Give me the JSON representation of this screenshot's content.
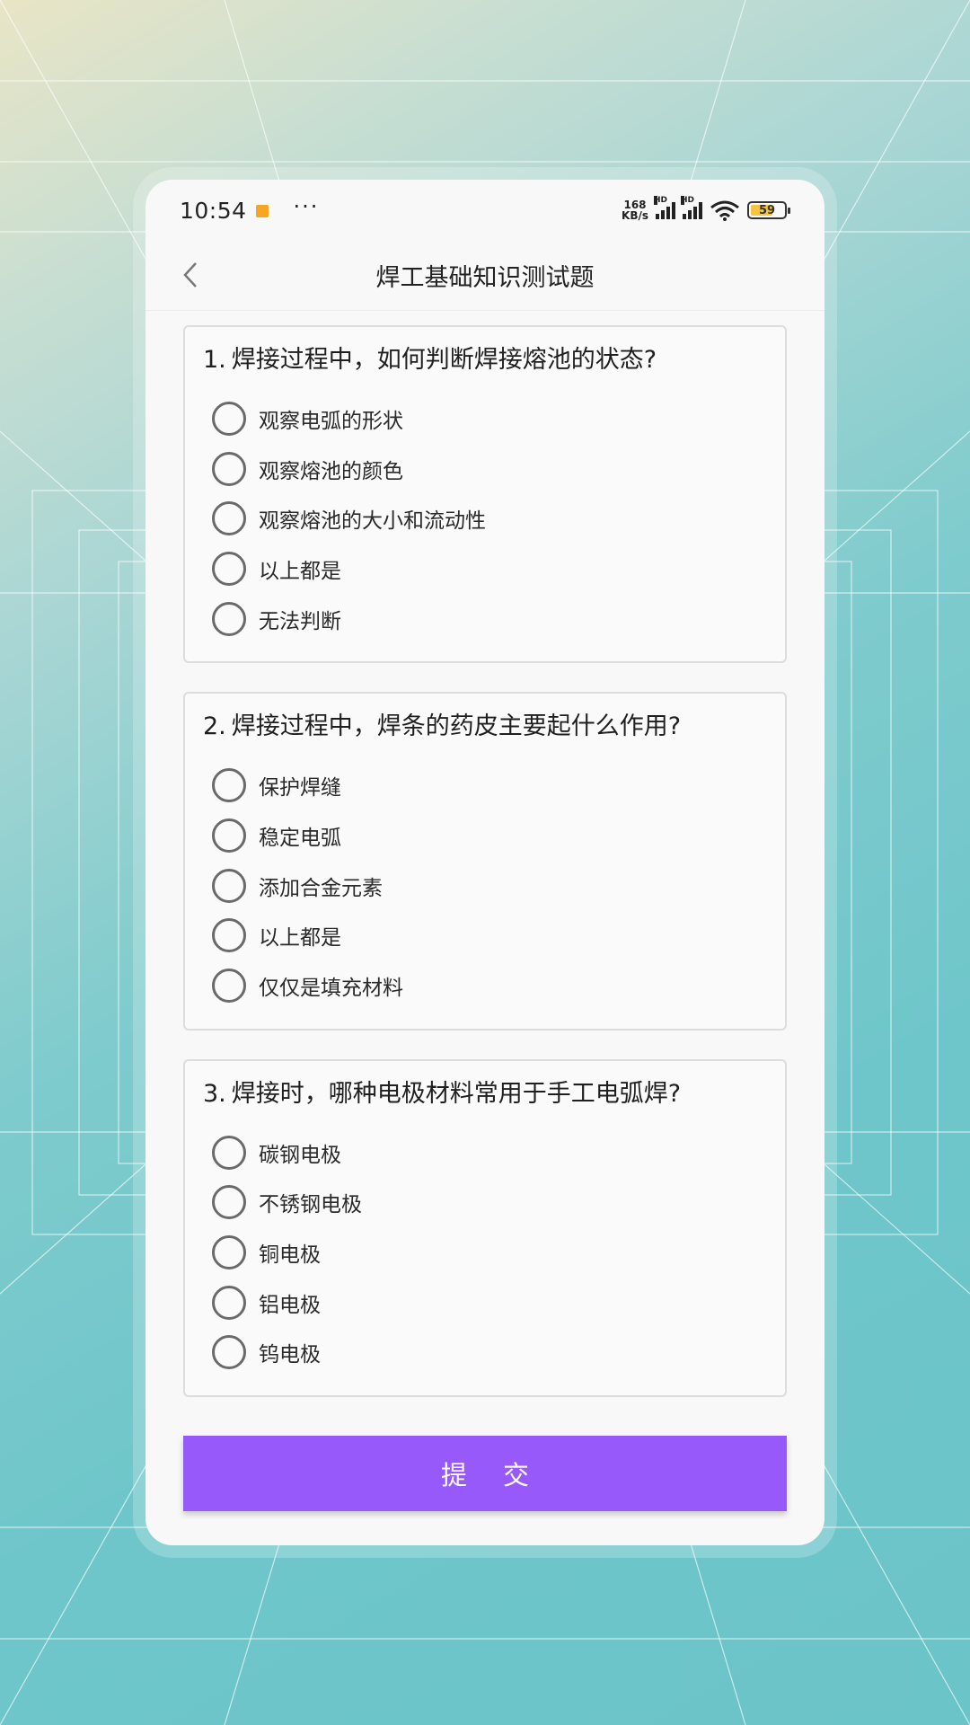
{
  "status_bar": {
    "time": "10:54",
    "net_speed_value": "168",
    "net_speed_unit": "KB/s",
    "signal_badge": "HD",
    "battery": "59",
    "icons": [
      "notification-icon",
      "more-icon",
      "signal-icon",
      "signal-icon",
      "wifi-icon",
      "battery-icon"
    ]
  },
  "header": {
    "title": "焊工基础知识测试题",
    "back_icon": "chevron-left-icon"
  },
  "questions": [
    {
      "number": "1.",
      "text": "焊接过程中，如何判断焊接熔池的状态?",
      "options": [
        "观察电弧的形状",
        "观察熔池的颜色",
        "观察熔池的大小和流动性",
        "以上都是",
        "无法判断"
      ]
    },
    {
      "number": "2.",
      "text": "焊接过程中，焊条的药皮主要起什么作用?",
      "options": [
        "保护焊缝",
        "稳定电弧",
        "添加合金元素",
        "以上都是",
        "仅仅是填充材料"
      ]
    },
    {
      "number": "3.",
      "text": "焊接时，哪种电极材料常用于手工电弧焊?",
      "options": [
        "碳钢电极",
        "不锈钢电极",
        "铜电极",
        "铝电极",
        "钨电极"
      ]
    }
  ],
  "submit": {
    "label": "提交"
  },
  "colors": {
    "accent": "#9859fb",
    "card_border": "#dcdcdc",
    "radio_border": "#6a6a6a"
  }
}
